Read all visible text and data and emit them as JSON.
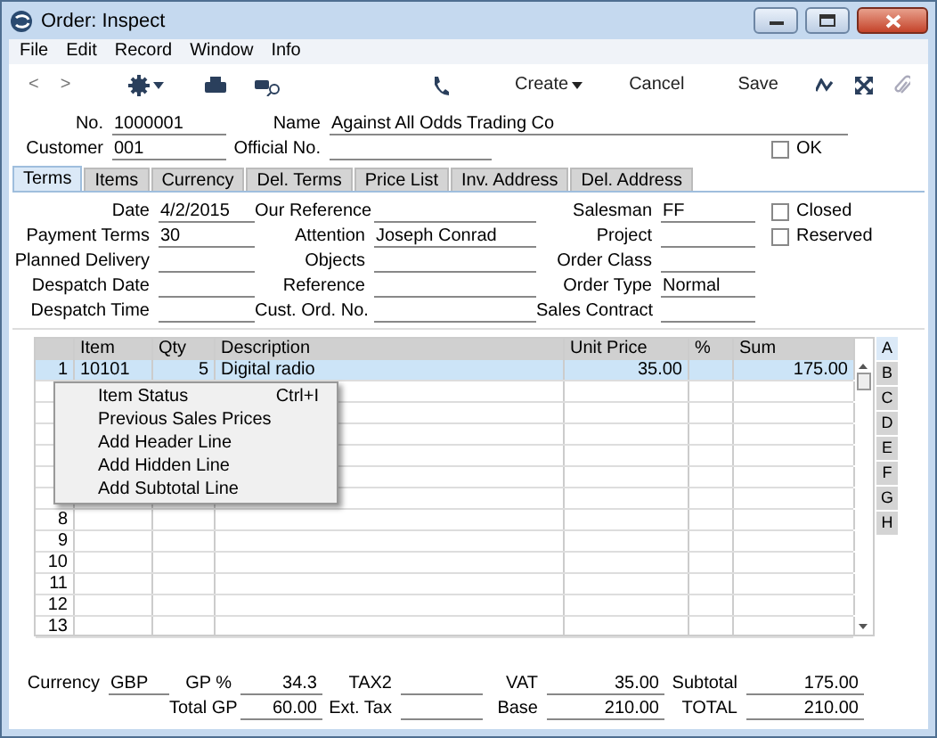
{
  "window": {
    "title": "Order: Inspect"
  },
  "menu": [
    "File",
    "Edit",
    "Record",
    "Window",
    "Info"
  ],
  "toolbar": {
    "nav": [
      "<",
      ">"
    ],
    "create": "Create",
    "cancel": "Cancel",
    "save": "Save"
  },
  "header": {
    "rows": [
      [
        {
          "label": "No.",
          "value": "1000001"
        },
        {
          "label": "Name",
          "value": "Against All Odds Trading Co"
        }
      ],
      [
        {
          "label": "Customer",
          "value": "001"
        },
        {
          "label": "Official No."
        }
      ]
    ],
    "ok": {
      "label": "OK",
      "checked": false
    }
  },
  "tabs": [
    {
      "label": "Terms",
      "selected": true
    },
    {
      "label": "Items",
      "selected": false
    },
    {
      "label": "Currency",
      "selected": false
    },
    {
      "label": "Del. Terms",
      "selected": false
    },
    {
      "label": "Price List",
      "selected": false
    },
    {
      "label": "Inv. Address",
      "selected": false
    },
    {
      "label": "Del. Address",
      "selected": false
    }
  ],
  "terms": {
    "rows": [
      [
        {
          "label": "Date",
          "value": "4/2/2015"
        },
        {
          "label": "Our Reference"
        },
        {
          "label": "Salesman",
          "value": "FF"
        }
      ],
      [
        {
          "label": "Payment Terms",
          "value": "30"
        },
        {
          "label": "Attention",
          "value": "Joseph Conrad"
        },
        {
          "label": "Project"
        }
      ],
      [
        {
          "label": "Planned Delivery"
        },
        {
          "label": "Objects"
        },
        {
          "label": "Order Class"
        }
      ],
      [
        {
          "label": "Despatch Date"
        },
        {
          "label": "Reference"
        },
        {
          "label": "Order Type",
          "value": "Normal"
        }
      ],
      [
        {
          "label": "Despatch Time"
        },
        {
          "label": "Cust. Ord. No."
        },
        {
          "label": "Sales Contract"
        }
      ]
    ],
    "checkboxes": [
      {
        "label": "Closed",
        "checked": false
      },
      {
        "label": "Reserved",
        "checked": false
      }
    ]
  },
  "table": {
    "columns": [
      "Item",
      "Qty",
      "Description",
      "Unit Price",
      "%",
      "Sum"
    ],
    "rows": [
      {
        "number": "1",
        "item": "10101",
        "qty": "5",
        "description": "Digital radio",
        "unit_price": "35.00",
        "sum": "175.00",
        "selected": true
      },
      {
        "selected": false
      },
      {
        "selected": false
      },
      {
        "selected": false
      },
      {
        "selected": false
      },
      {
        "selected": false
      },
      {
        "selected": false
      },
      {
        "number": "8",
        "selected": false
      },
      {
        "number": "9",
        "selected": false
      },
      {
        "number": "10",
        "selected": false
      },
      {
        "number": "11",
        "selected": false
      },
      {
        "number": "12",
        "selected": false
      },
      {
        "number": "13",
        "selected": false
      }
    ]
  },
  "side_tabs": [
    {
      "label": "A",
      "selected": true
    },
    {
      "label": "B",
      "selected": false
    },
    {
      "label": "C",
      "selected": false
    },
    {
      "label": "D",
      "selected": false
    },
    {
      "label": "E",
      "selected": false
    },
    {
      "label": "F",
      "selected": false
    },
    {
      "label": "G",
      "selected": false
    },
    {
      "label": "H",
      "selected": false
    }
  ],
  "context_menu": [
    {
      "label": "Item Status",
      "shortcut": "Ctrl+I"
    },
    {
      "label": "Previous Sales Prices"
    },
    {
      "label": "Add Header Line"
    },
    {
      "label": "Add Hidden Line"
    },
    {
      "label": "Add Subtotal Line"
    }
  ],
  "currency": {
    "label": "Currency",
    "value": "GBP"
  },
  "totals": {
    "rows": [
      [
        {
          "label": "GP %",
          "value": "34.3"
        },
        {
          "label": "TAX2"
        },
        {
          "label": "VAT",
          "value": "35.00"
        },
        {
          "label": "Subtotal",
          "value": "175.00"
        }
      ],
      [
        {
          "label": "Total GP",
          "value": "60.00"
        },
        {
          "label": "Ext. Tax"
        },
        {
          "label": "Base",
          "value": "210.00"
        },
        {
          "label": "TOTAL",
          "value": "210.00"
        }
      ]
    ]
  }
}
